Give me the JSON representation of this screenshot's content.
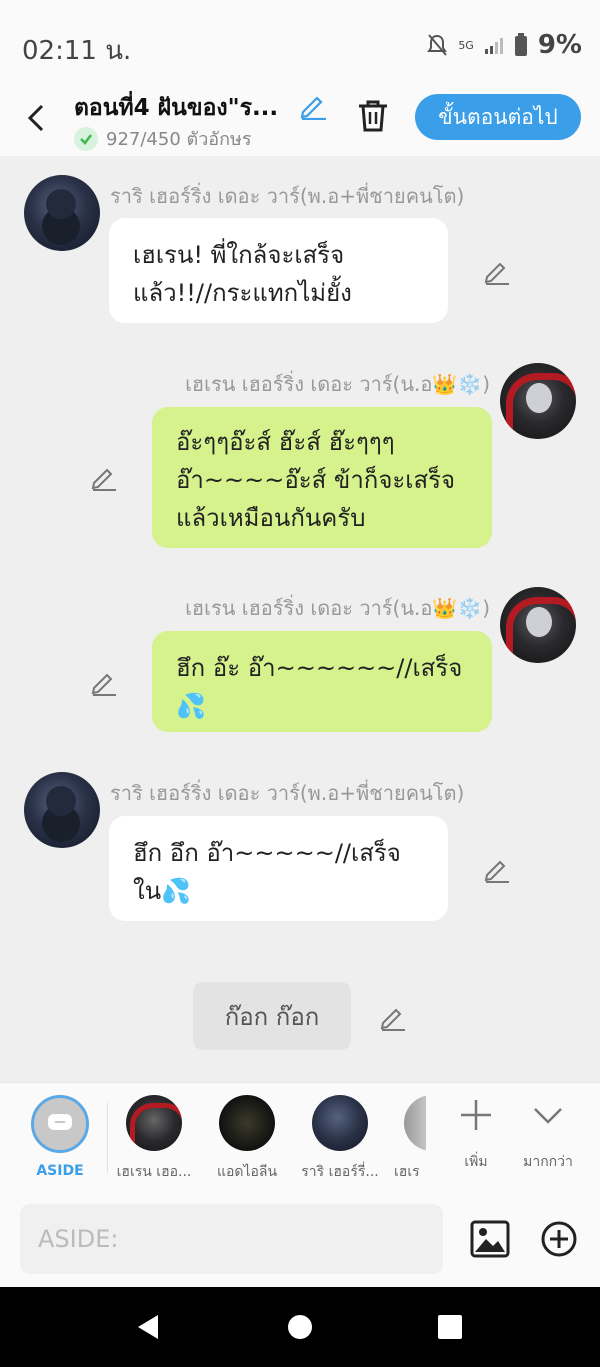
{
  "status_bar": {
    "time": "02:11 น.",
    "battery": "9%",
    "network": "5G"
  },
  "header": {
    "title": "ตอนที่4 ฝันของ\"ร...",
    "counter": "927/450 ตัวอักษร",
    "next_label": "ขั้นตอนต่อไป"
  },
  "messages": [
    {
      "sender": "ราริ เฮอร์ริ่ง เดอะ วาร์(พ.อ+พี่ชายคนโต)",
      "lines": [
        "เฮเรน! พี่ใกล้จะเสร็จ",
        "แล้ว!!//กระแทกไม่ยั้ง"
      ]
    },
    {
      "sender": "เฮเรน เฮอร์ริ่ง เดอะ วาร์(น.อ👑❄️)",
      "lines": [
        "อ๊ะๆๆอ๊ะส์ ฮ๊ะส์ ฮ๊ะๆๆๆ",
        "อ๊า~~~~อ๊ะส์ ข้าก็จะเสร็จ",
        "แล้วเหมือนกันครับ"
      ]
    },
    {
      "sender": "เฮเรน เฮอร์ริ่ง เดอะ วาร์(น.อ👑❄️)",
      "lines": [
        "ฮึก อ๊ะ อ๊า~~~~~~//เสร็จ",
        "💦"
      ]
    },
    {
      "sender": "ราริ เฮอร์ริ่ง เดอะ วาร์(พ.อ+พี่ชายคนโต)",
      "lines": [
        "ฮึก อึก อ๊า~~~~~//เสร็จ",
        "ใน💦"
      ]
    }
  ],
  "aside_message": "ก๊อก ก๊อก",
  "character_tray": [
    {
      "label": "ASIDE"
    },
    {
      "label": "เฮเรน เฮอ..."
    },
    {
      "label": "แอดไอลีน"
    },
    {
      "label": "ราริ เฮอร์รี่..."
    },
    {
      "label": "เฮเร"
    }
  ],
  "tray_actions": {
    "add_label": "เพิ่ม",
    "more_label": "มากกว่า"
  },
  "composer": {
    "placeholder": "ASIDE:"
  }
}
